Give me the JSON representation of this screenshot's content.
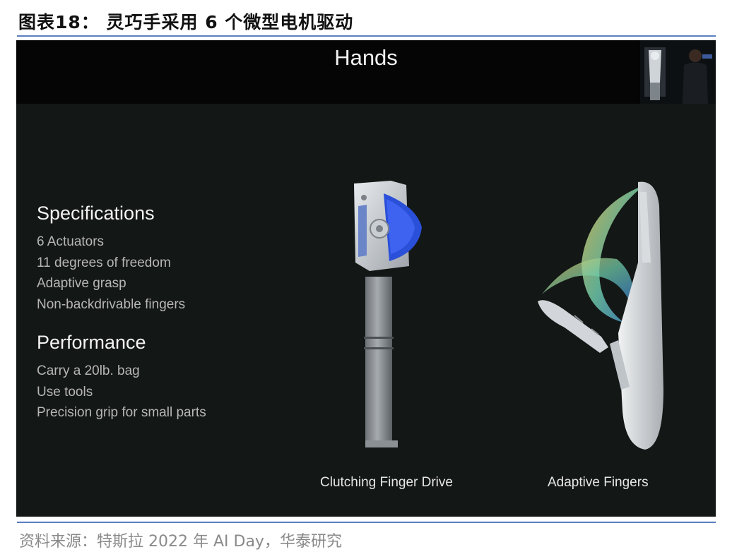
{
  "figure": {
    "title": "图表18：  灵巧手采用 6 个微型电机驱动",
    "source": "资料来源：特斯拉 2022 年 AI Day，华泰研究"
  },
  "slide": {
    "title": "Hands",
    "specifications": {
      "heading": "Specifications",
      "items": [
        "6 Actuators",
        "11 degrees of freedom",
        "Adaptive grasp",
        "Non-backdrivable fingers"
      ]
    },
    "performance": {
      "heading": "Performance",
      "items": [
        "Carry a 20lb. bag",
        "Use tools",
        "Precision grip for small parts"
      ]
    },
    "captions": {
      "left": "Clutching Finger Drive",
      "right": "Adaptive Fingers"
    }
  },
  "colors": {
    "accent_rule": "#5b7fc0",
    "gear_blue": "#2a4fd8",
    "slide_bg": "#131715",
    "header_bg": "#050505"
  }
}
